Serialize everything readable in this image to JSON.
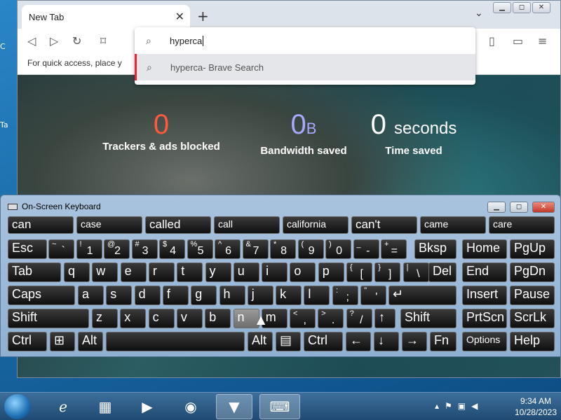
{
  "desktop": {
    "icon_labels": [
      "C",
      "Ta"
    ]
  },
  "browser": {
    "tab_title": "New Tab",
    "tab_close": "✕",
    "new_tab": "+",
    "tab_dropdown": "⌄",
    "bookmarks_hint": "For quick access, place y",
    "omnibox": {
      "value": "hyperca",
      "suggestion_query": "hyperca",
      "suggestion_source": " - Brave Search"
    },
    "stats": [
      {
        "value": "0",
        "unit": "",
        "label": "Trackers & ads blocked",
        "color": "#ff5a3c"
      },
      {
        "value": "0",
        "unit": "B",
        "label": "Bandwidth saved",
        "color": "#a8a8ff"
      },
      {
        "value": "0",
        "unit": "seconds",
        "label": "Time saved",
        "color": "#ffffff"
      }
    ]
  },
  "osk": {
    "title": "On-Screen Keyboard",
    "predictions": [
      "can",
      "case",
      "called",
      "call",
      "california",
      "can't",
      "came",
      "care"
    ],
    "keys": {
      "esc": "Esc",
      "tab": "Tab",
      "caps": "Caps",
      "shift": "Shift",
      "ctrl": "Ctrl",
      "alt": "Alt",
      "bksp": "Bksp",
      "del": "Del",
      "enter": "↵",
      "home": "Home",
      "pgup": "PgUp",
      "end": "End",
      "pgdn": "PgDn",
      "insert": "Insert",
      "pause": "Pause",
      "prtscn": "PrtScn",
      "scrlk": "ScrLk",
      "options": "Options",
      "help": "Help",
      "fn": "Fn",
      "win": "⊞",
      "menu": "▤",
      "left": "←",
      "down": "↓",
      "right": "→",
      "up": "↑"
    },
    "number_row": [
      {
        "top": "~",
        "bottom": "`"
      },
      {
        "top": "!",
        "bottom": "1"
      },
      {
        "top": "@",
        "bottom": "2"
      },
      {
        "top": "#",
        "bottom": "3"
      },
      {
        "top": "$",
        "bottom": "4"
      },
      {
        "top": "%",
        "bottom": "5"
      },
      {
        "top": "^",
        "bottom": "6"
      },
      {
        "top": "&",
        "bottom": "7"
      },
      {
        "top": "*",
        "bottom": "8"
      },
      {
        "top": "(",
        "bottom": "9"
      },
      {
        "top": ")",
        "bottom": "0"
      },
      {
        "top": "_",
        "bottom": "-"
      },
      {
        "top": "+",
        "bottom": "="
      }
    ],
    "row_q": [
      "q",
      "w",
      "e",
      "r",
      "t",
      "y",
      "u",
      "i",
      "o",
      "p"
    ],
    "row_q_sym": [
      {
        "top": "{",
        "bottom": "["
      },
      {
        "top": "}",
        "bottom": "]"
      },
      {
        "top": "|",
        "bottom": "\\"
      }
    ],
    "row_a": [
      "a",
      "s",
      "d",
      "f",
      "g",
      "h",
      "j",
      "k",
      "l"
    ],
    "row_a_sym": [
      {
        "top": ":",
        "bottom": ";"
      },
      {
        "top": "\"",
        "bottom": "'"
      }
    ],
    "row_z": [
      "z",
      "x",
      "c",
      "v",
      "b",
      "n",
      "m"
    ],
    "row_z_sym": [
      {
        "top": "<",
        "bottom": ","
      },
      {
        "top": ">",
        "bottom": "."
      },
      {
        "top": "?",
        "bottom": "/"
      }
    ],
    "highlighted_key": "n"
  },
  "taskbar": {
    "time": "9:34 AM",
    "date": "10/28/2023",
    "apps": [
      "internet-explorer",
      "file-explorer",
      "media-player",
      "chrome",
      "brave",
      "on-screen-keyboard"
    ]
  }
}
